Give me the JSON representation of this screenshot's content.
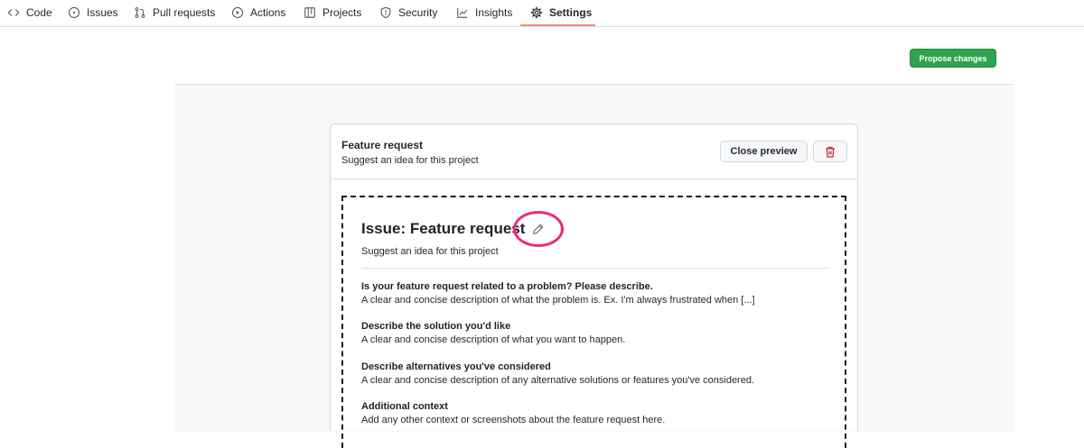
{
  "nav": {
    "tabs": [
      {
        "label": "Code",
        "icon": "code-icon"
      },
      {
        "label": "Issues",
        "icon": "issue-opened-icon"
      },
      {
        "label": "Pull requests",
        "icon": "git-pull-request-icon"
      },
      {
        "label": "Actions",
        "icon": "play-icon"
      },
      {
        "label": "Projects",
        "icon": "table-icon"
      },
      {
        "label": "Security",
        "icon": "shield-icon"
      },
      {
        "label": "Insights",
        "icon": "graph-icon"
      },
      {
        "label": "Settings",
        "icon": "gear-icon"
      }
    ],
    "active": "Settings",
    "accent": "#fd8c73"
  },
  "actions": {
    "propose_label": "Propose changes",
    "propose_color": "#2da44e"
  },
  "template": {
    "name": "Feature request",
    "about": "Suggest an idea for this project",
    "close_preview_label": "Close preview",
    "delete_icon": "trash-icon"
  },
  "preview": {
    "title": "Issue: Feature request",
    "edit_icon": "pencil-icon",
    "subtitle": "Suggest an idea for this project",
    "highlight_color": "#f1287b",
    "sections": [
      {
        "heading": "Is your feature request related to a problem? Please describe.",
        "body": "A clear and concise description of what the problem is. Ex. I'm always frustrated when [...]"
      },
      {
        "heading": "Describe the solution you'd like",
        "body": "A clear and concise description of what you want to happen."
      },
      {
        "heading": "Describe alternatives you've considered",
        "body": "A clear and concise description of any alternative solutions or features you've considered."
      },
      {
        "heading": "Additional context",
        "body": "Add any other context or screenshots about the feature request here."
      }
    ]
  }
}
